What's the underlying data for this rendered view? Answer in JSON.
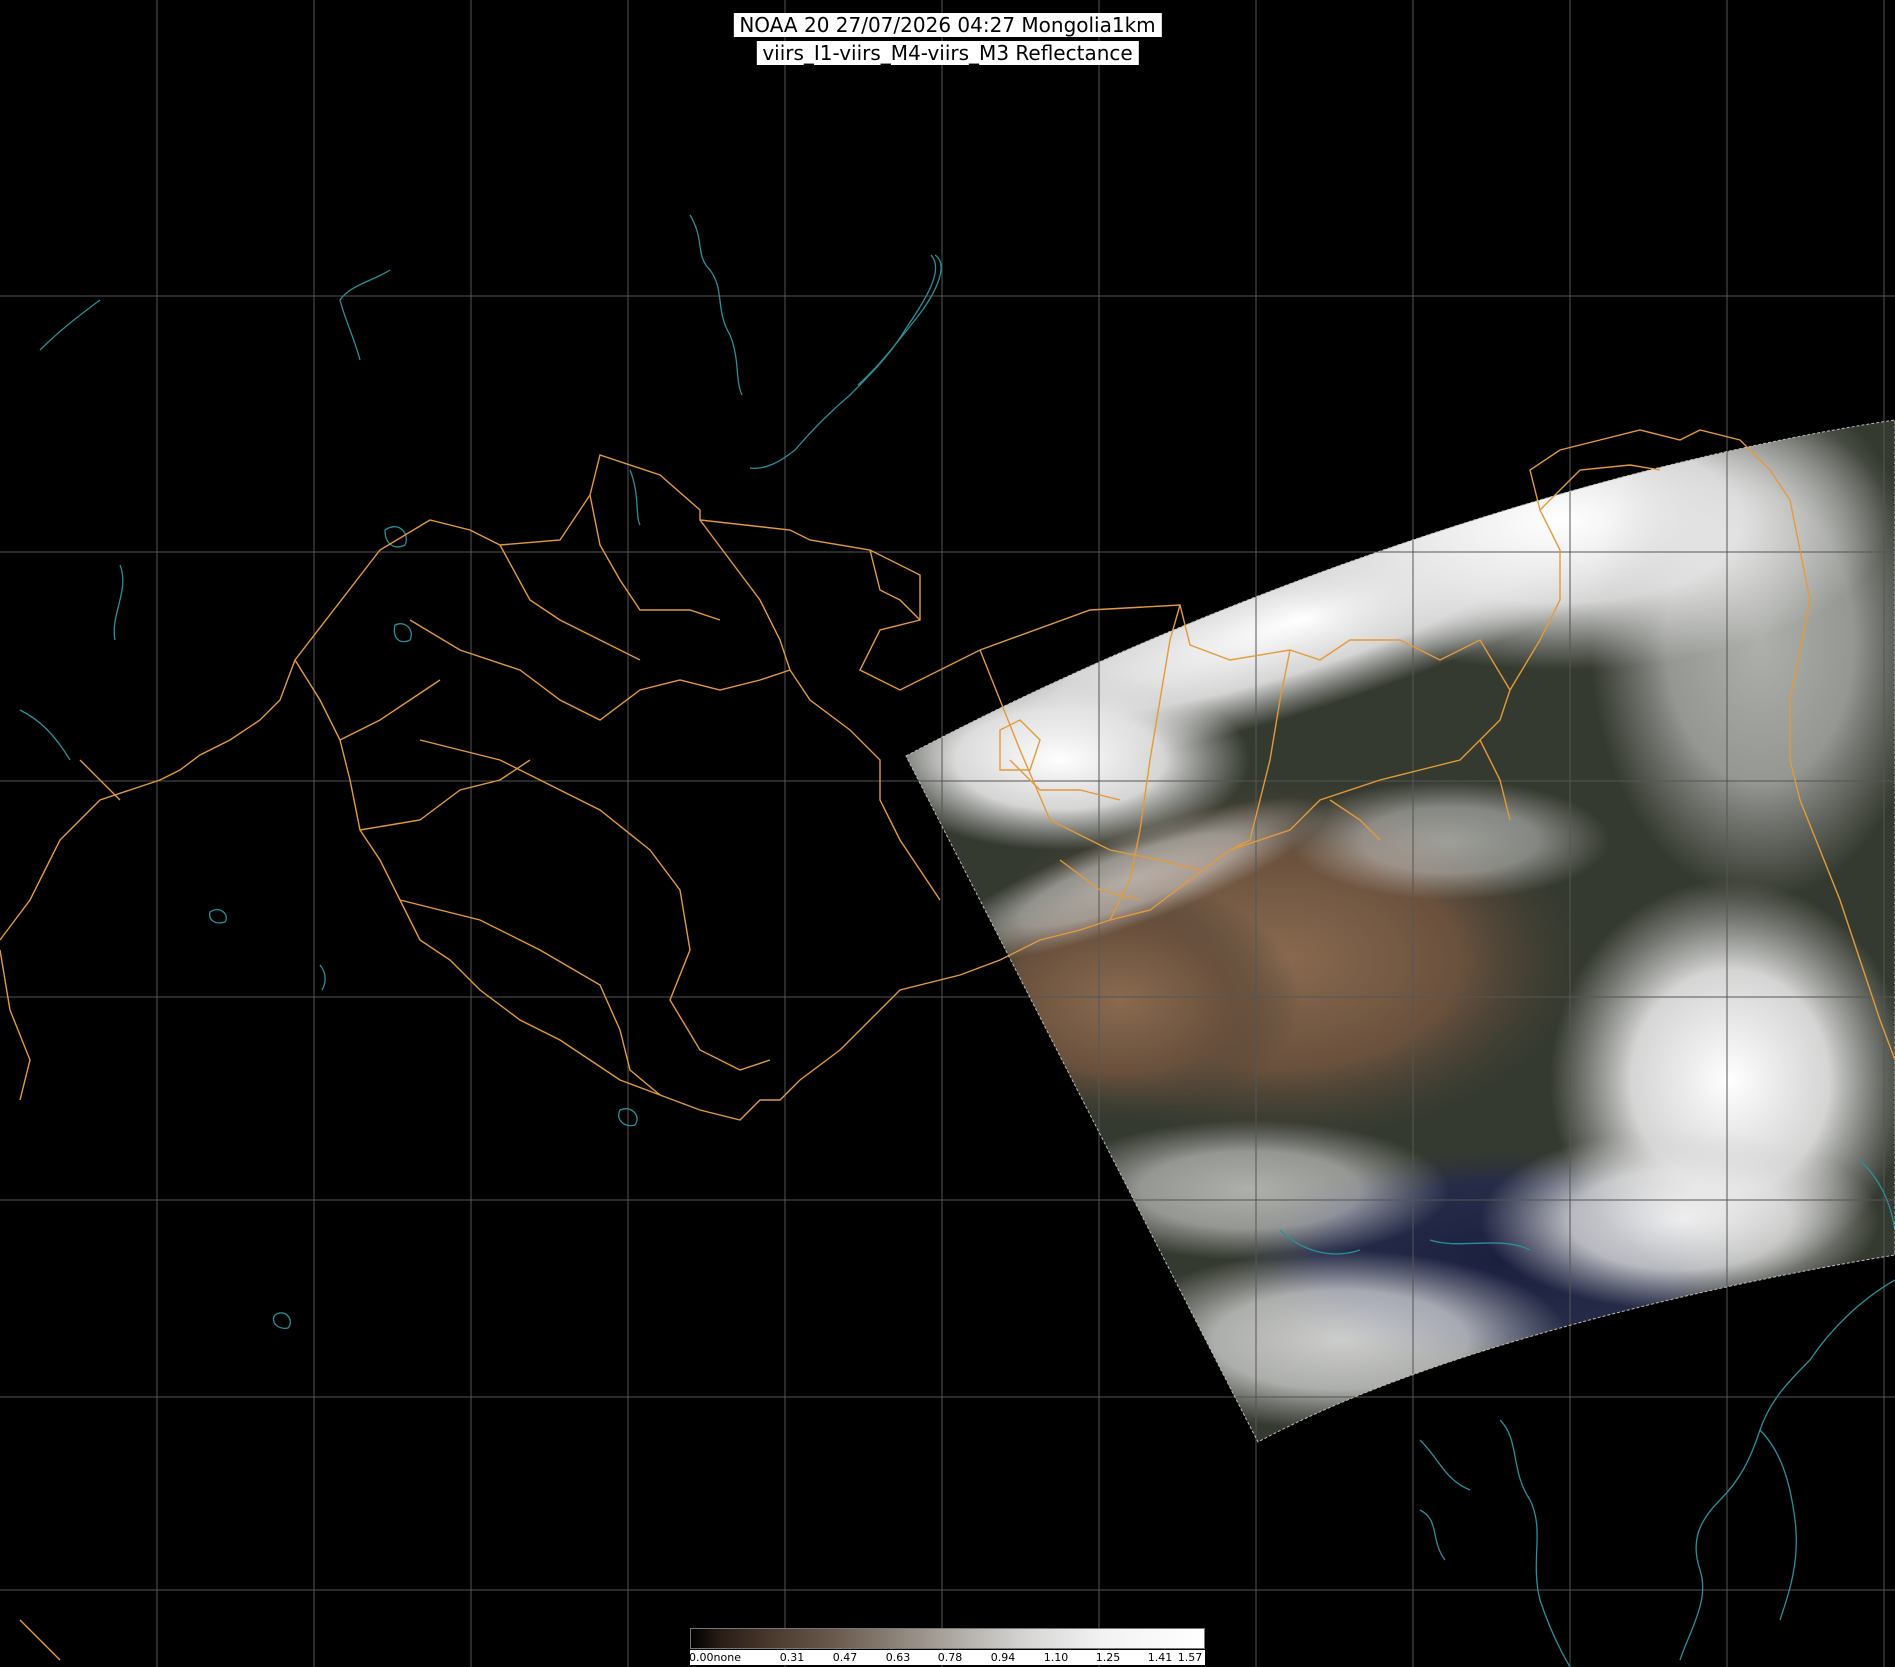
{
  "header": {
    "line1": "NOAA 20 27/07/2026 04:27 Mongolia1km",
    "line2": "viirs_I1-viirs_M4-viirs_M3 Reflectance"
  },
  "colorbar": {
    "labels": [
      "0.00none",
      "0.31",
      "0.47",
      "0.63",
      "0.78",
      "0.94",
      "1.10",
      "1.25",
      "1.41",
      "1.57"
    ],
    "colors": [
      "#000000",
      "#2a1e17",
      "#4b3a2e",
      "#6a5a4e",
      "#8c8278",
      "#b3afaa",
      "#d8d7d6",
      "#f2f2f2",
      "#ffffff"
    ]
  },
  "colors": {
    "background": "#000000",
    "graticule": "#555555",
    "boundary": "#e39a3c",
    "coastline": "#2a8f9a",
    "cloud": "#f4f4f4",
    "land_brown": "#7a5c44",
    "land_dark": "#2f3529",
    "water": "#1f2540"
  },
  "map": {
    "region": "Mongolia1km",
    "satellite": "NOAA 20"
  }
}
